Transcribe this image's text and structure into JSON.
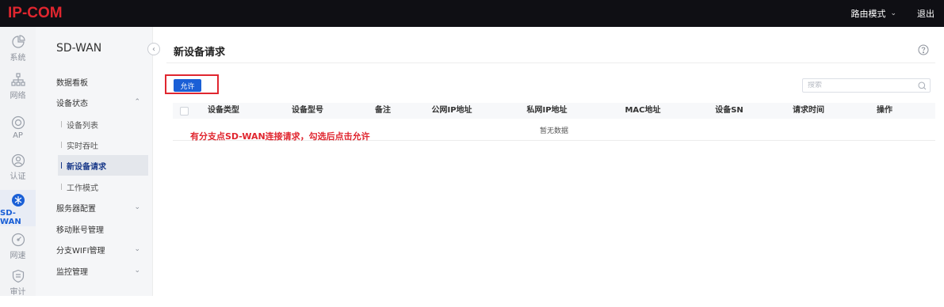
{
  "brand": {
    "logo_text": "IP-COM",
    "logo_color": "#e0262f"
  },
  "header": {
    "mode_label": "路由模式",
    "logout_label": "退出"
  },
  "rail": {
    "items": [
      {
        "label": "系统",
        "icon": "pie-chart-icon"
      },
      {
        "label": "网络",
        "icon": "network-topology-icon"
      },
      {
        "label": "AP",
        "icon": "ap-target-icon"
      },
      {
        "label": "认证",
        "icon": "auth-shield-icon"
      },
      {
        "label": "SD-WAN",
        "icon": "sd-wan-icon",
        "active": true
      },
      {
        "label": "网速",
        "icon": "speedometer-icon"
      },
      {
        "label": "审计",
        "icon": "audit-shield-icon"
      }
    ]
  },
  "subnav": {
    "title": "SD-WAN",
    "items": [
      {
        "label": "数据看板"
      },
      {
        "label": "设备状态",
        "expanded": true
      },
      {
        "label": "设备列表"
      },
      {
        "label": "实时吞吐"
      },
      {
        "label": "新设备请求",
        "active": true
      },
      {
        "label": "工作模式"
      },
      {
        "label": "服务器配置"
      },
      {
        "label": "移动账号管理"
      },
      {
        "label": "分支WIFI管理"
      },
      {
        "label": "监控管理"
      }
    ]
  },
  "main": {
    "title": "新设备请求",
    "allow_button": "允许",
    "search_placeholder": "搜索",
    "columns": [
      "设备类型",
      "设备型号",
      "备注",
      "公网IP地址",
      "私网IP地址",
      "MAC地址",
      "设备SN",
      "请求时间",
      "操作"
    ],
    "empty_text": "暂无数据",
    "annotation": "有分支点SD-WAN连接请求，勾选后点击允许"
  },
  "colors": {
    "accent": "#1a5fd6",
    "highlight": "#e0262f",
    "topbar": "#0f0f14"
  }
}
